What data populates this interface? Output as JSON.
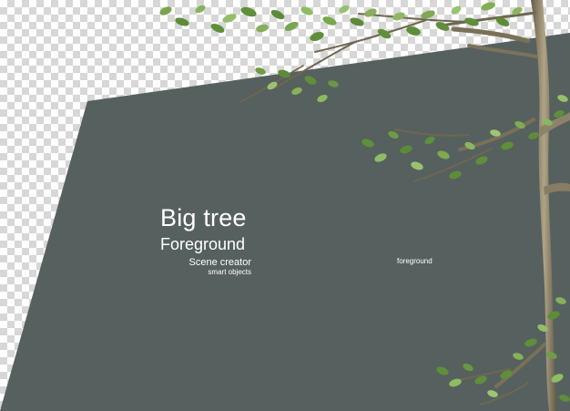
{
  "canvas": {
    "background": "transparent-checkerboard",
    "panel_color": "#56605f"
  },
  "text": {
    "title": "Big tree",
    "subtitle": "Foreground",
    "credit_line_1": "Scene creator",
    "credit_line_2": "smart objects",
    "tag": "foreground"
  },
  "tree": {
    "leaf_color": "#5f8f3a",
    "leaf_light": "#8bbb5c",
    "bark_color": "#8d8369"
  }
}
